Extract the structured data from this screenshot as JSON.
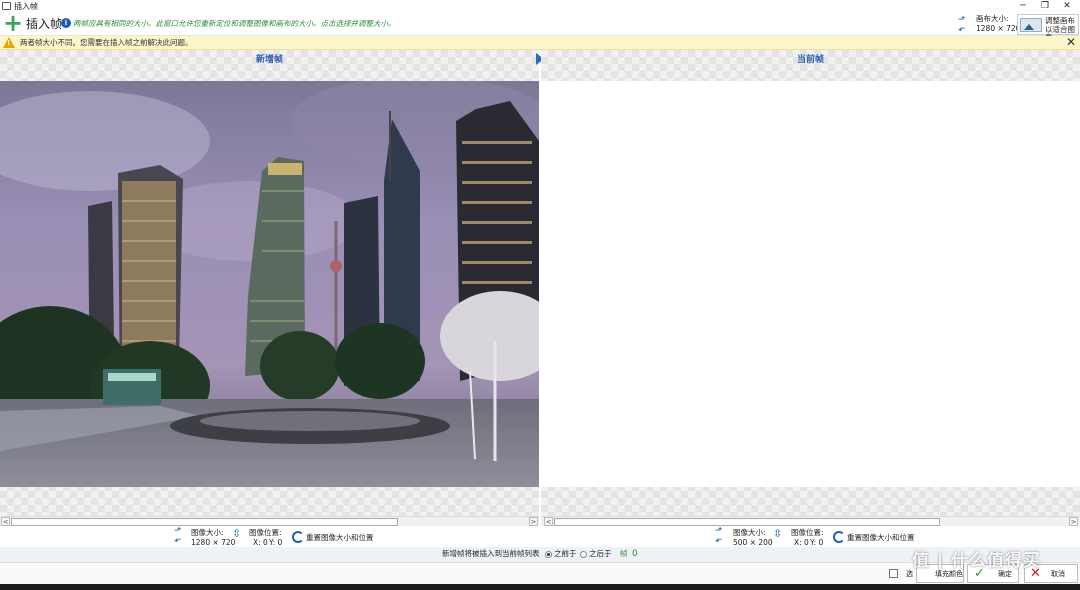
{
  "window": {
    "title": "插入帧",
    "min": "─",
    "restore": "❐",
    "close": "✕"
  },
  "header": {
    "title": "插入帧",
    "info": "i",
    "description": "两帧应具有相同的大小。此窗口允许您重新定位和调整图像和画布的大小。点击选择并调整大小。",
    "canvas_size_label": "画布大小:",
    "canvas_size_value": "1280 × 720",
    "fit_button_label": "调整画布以适合图像",
    "fit_line1": "调整画布",
    "fit_line2": "以适合图像"
  },
  "warning": {
    "text": "两者帧大小不同。您需要在插入帧之前解决此问题。",
    "close": "✕",
    "icon_mark": "!"
  },
  "left_pane": {
    "title": "新增帧",
    "image_size_label": "图像大小:",
    "image_size_value": "1280 × 720",
    "image_pos_label": "图像位置:",
    "pos_x": "X: 0",
    "pos_y": "Y: 0",
    "reset_label": "重置图像大小和位置"
  },
  "right_pane": {
    "title": "当前帧",
    "image_size_label": "图像大小:",
    "image_size_value": "500 × 200",
    "image_pos_label": "图像位置:",
    "pos_x": "X: 0",
    "pos_y": "Y: 0",
    "reset_label": "重置图像大小和位置"
  },
  "status": {
    "text": "新增帧将被插入到当前帧列表",
    "before_label": "之前于",
    "after_label": "之后于",
    "frame_label": "帧",
    "frame_value": "0"
  },
  "bottom": {
    "checkbox_label": "选",
    "fill_label": "填充颜色",
    "ok_label": "确定",
    "cancel_label": "取消",
    "ok_icon": "✓",
    "cancel_icon": "✕"
  },
  "scroll": {
    "left": "<",
    "right": ">"
  },
  "watermark": "值 | 什么值得买",
  "colors": {
    "accent": "#1a5fb4",
    "warning_bg": "#fdf6c9",
    "info_green": "#2e8b3a",
    "plus_green": "#3fa35a"
  }
}
